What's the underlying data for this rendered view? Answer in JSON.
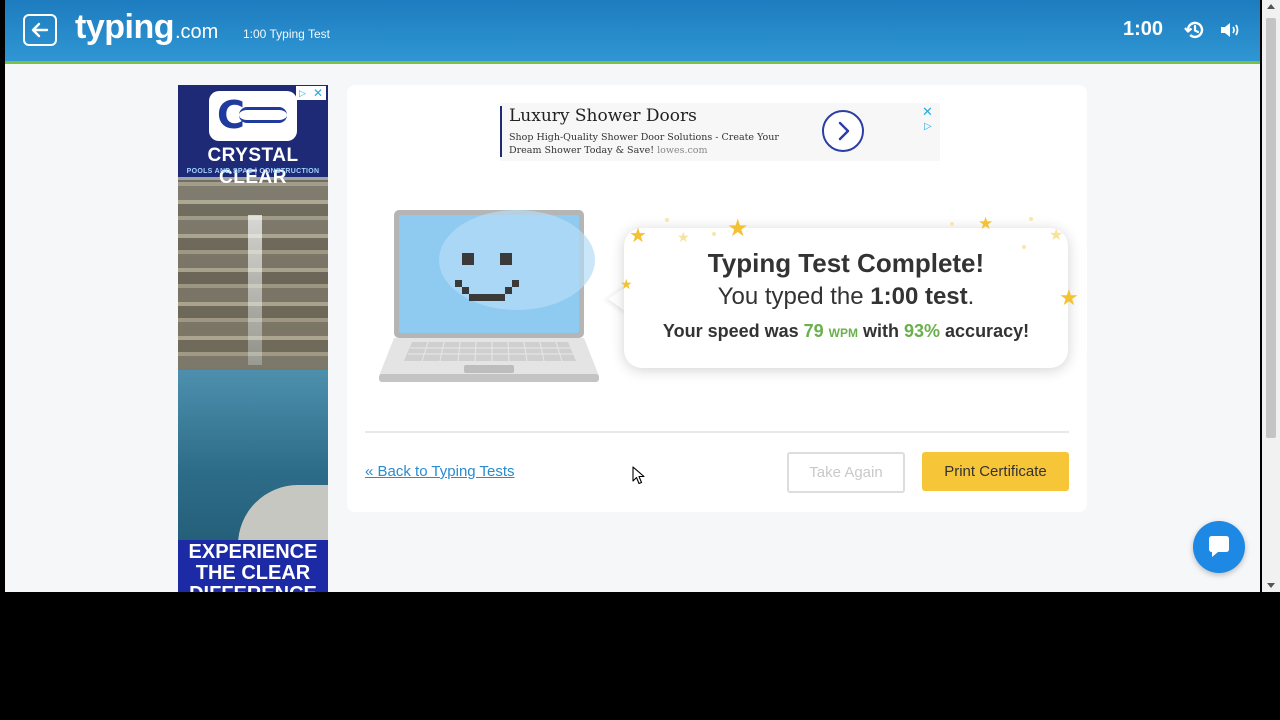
{
  "header": {
    "logo_main": "typing",
    "logo_suffix": ".com",
    "test_name": "1:00 Typing Test",
    "timer": "1:00",
    "accent_color": "#2f96d3",
    "border_color": "#7ac143"
  },
  "side_ad": {
    "brand": "CRYSTAL CLEAR",
    "tagline": "POOLS AND SPAS | CONSTRUCTION",
    "bottom_line1": "EXPERIENCE",
    "bottom_line2": "THE CLEAR",
    "bottom_line3": "DIFFERENCE"
  },
  "banner_ad": {
    "title": "Luxury Shower Doors",
    "description": "Shop High-Quality Shower Door Solutions - Create Your Dream Shower Today & Save!",
    "domain": "lowes.com"
  },
  "result": {
    "heading": "Typing Test Complete!",
    "line2_prefix": "You typed the ",
    "line2_bold": "1:00 test",
    "line2_suffix": ".",
    "speed_prefix": "Your speed was ",
    "speed_value": "79",
    "speed_unit": "WPM",
    "speed_mid": " with ",
    "accuracy_value": "93%",
    "accuracy_suffix": " accuracy!"
  },
  "actions": {
    "back_link": "« Back to Typing Tests",
    "take_again": "Take Again",
    "print_certificate": "Print Certificate",
    "print_color": "#f7c538"
  },
  "icons": {
    "back": "arrow-left-icon",
    "history": "history-icon",
    "volume": "volume-icon",
    "chat": "chat-icon",
    "banner_go": "chevron-right-icon"
  }
}
